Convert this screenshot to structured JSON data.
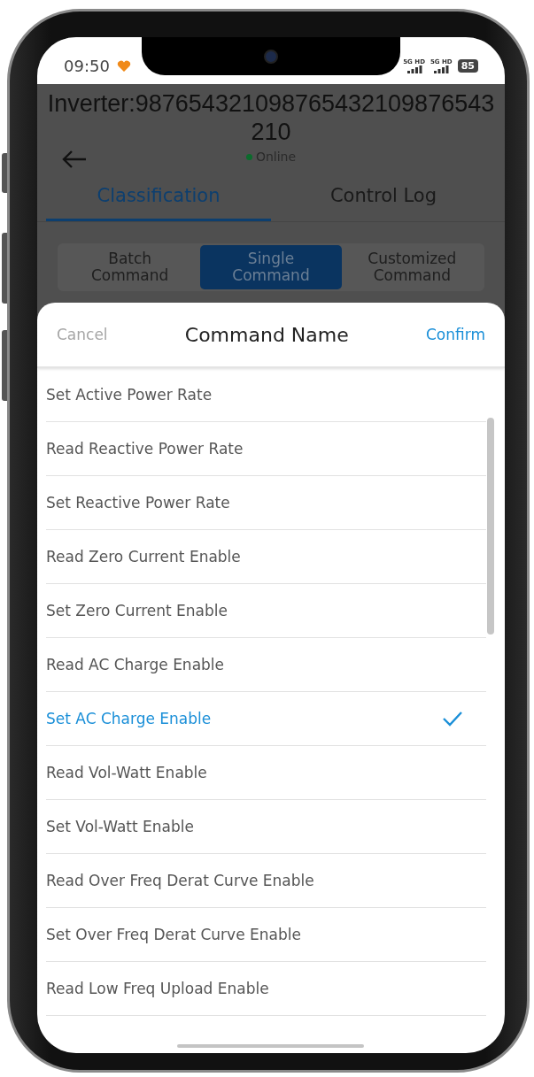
{
  "status_bar": {
    "time": "09:50",
    "networks": [
      "5G HD",
      "5G HD"
    ],
    "battery": "85"
  },
  "header": {
    "title": "Inverter:987654321098765432109876543210",
    "status": "Online"
  },
  "tabs": [
    {
      "label": "Classification",
      "selected": true
    },
    {
      "label": "Control Log",
      "selected": false
    }
  ],
  "segments": [
    {
      "label": "Batch Command",
      "selected": false
    },
    {
      "label": "Single Command",
      "selected": true
    },
    {
      "label": "Customized Command",
      "selected": false
    }
  ],
  "sheet": {
    "cancel": "Cancel",
    "title": "Command Name",
    "confirm": "Confirm"
  },
  "commands": [
    {
      "label": "Set Active Power Rate",
      "selected": false
    },
    {
      "label": "Read Reactive Power Rate",
      "selected": false
    },
    {
      "label": "Set Reactive Power Rate",
      "selected": false
    },
    {
      "label": "Read Zero Current Enable",
      "selected": false
    },
    {
      "label": "Set Zero Current Enable",
      "selected": false
    },
    {
      "label": "Read AC Charge Enable",
      "selected": false
    },
    {
      "label": "Set AC Charge Enable",
      "selected": true
    },
    {
      "label": "Read Vol-Watt Enable",
      "selected": false
    },
    {
      "label": "Set Vol-Watt Enable",
      "selected": false
    },
    {
      "label": "Read Over Freq Derat Curve Enable",
      "selected": false
    },
    {
      "label": "Set Over Freq Derat Curve Enable",
      "selected": false
    },
    {
      "label": "Read Low Freq Upload Enable",
      "selected": false
    }
  ]
}
